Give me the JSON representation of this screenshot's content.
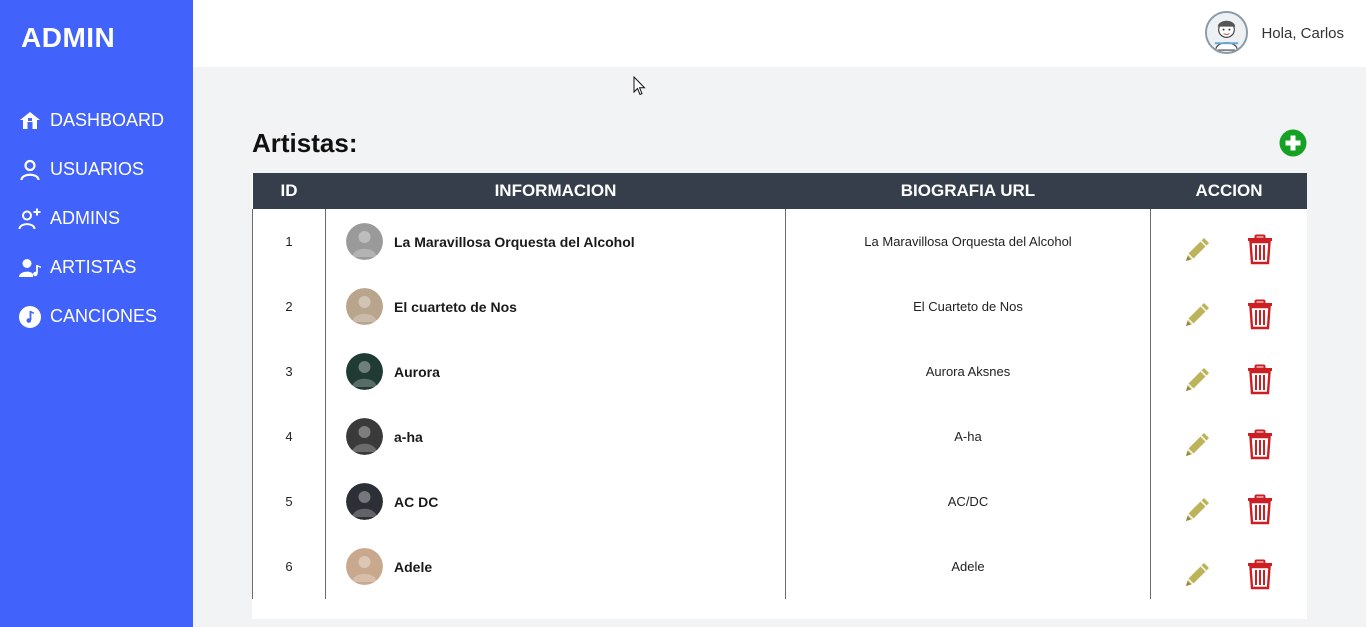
{
  "sidebar": {
    "brand": "ADMIN",
    "items": [
      {
        "label": "DASHBOARD",
        "icon": "home-icon"
      },
      {
        "label": "USUARIOS",
        "icon": "user-icon"
      },
      {
        "label": "ADMINS",
        "icon": "user-plus-icon"
      },
      {
        "label": "ARTISTAS",
        "icon": "user-music-icon"
      },
      {
        "label": "CANCIONES",
        "icon": "music-note-icon"
      }
    ]
  },
  "header": {
    "greeting": "Hola, Carlos",
    "avatar_icon": "user-avatar-icon"
  },
  "main": {
    "title": "Artistas:",
    "add_icon": "plus-circle-icon",
    "table": {
      "columns": [
        "ID",
        "INFORMACION",
        "BIOGRAFIA URL",
        "ACCION"
      ],
      "rows": [
        {
          "id": "1",
          "name": "La Maravillosa Orquesta del Alcohol",
          "bio": "La Maravillosa Orquesta del Alcohol",
          "thumb_color": "#9a9a9a"
        },
        {
          "id": "2",
          "name": "El cuarteto de Nos",
          "bio": "El Cuarteto de Nos",
          "thumb_color": "#b9a58c"
        },
        {
          "id": "3",
          "name": "Aurora",
          "bio": "Aurora Aksnes",
          "thumb_color": "#1f3b33"
        },
        {
          "id": "4",
          "name": "a-ha",
          "bio": "A-ha",
          "thumb_color": "#3a3a3a"
        },
        {
          "id": "5",
          "name": "AC DC",
          "bio": "AC/DC",
          "thumb_color": "#2d2f36"
        },
        {
          "id": "6",
          "name": "Adele",
          "bio": "Adele",
          "thumb_color": "#c9a98e"
        }
      ]
    },
    "colors": {
      "sidebar": "#4162fb",
      "table_header": "#363e4b",
      "edit": "#bdb35a",
      "delete": "#cc1f24",
      "add": "#17a124"
    }
  }
}
